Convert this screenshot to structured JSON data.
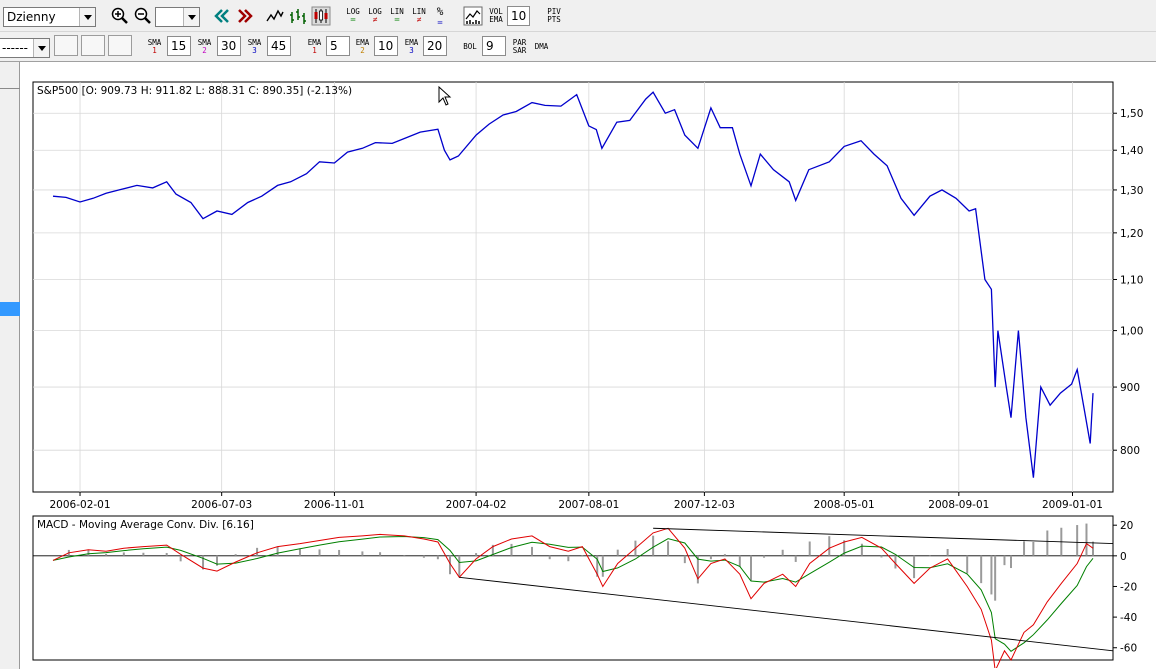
{
  "toolbar1": {
    "interval_value": "Dzienny",
    "zoom_in_icon": "magnifier-plus-icon",
    "zoom_out_icon": "magnifier-minus-icon",
    "zoom_value": "",
    "log_label": "LOG",
    "log2_label": "LOG",
    "lin_label": "LIN",
    "lin2_label": "LIN",
    "percent_label": "%",
    "vol_label": "VOL",
    "ema_label": "EMA",
    "vol_ema_value": "10",
    "piv_label": "PIV",
    "pts_label": "PTS"
  },
  "toolbar2": {
    "line_style_value": "------",
    "sma_label": "SMA",
    "sma1_num": "1",
    "sma1_value": "15",
    "sma2_num": "2",
    "sma2_value": "30",
    "sma3_num": "3",
    "sma3_value": "45",
    "ema_label": "EMA",
    "ema1_num": "1",
    "ema1_value": "5",
    "ema2_num": "2",
    "ema2_value": "10",
    "ema3_num": "3",
    "ema3_value": "20",
    "bol_label": "BOL",
    "bol_value": "9",
    "par_label": "PAR",
    "sar_label": "SAR",
    "dma_label": "DMA"
  },
  "colors": {
    "price": "#0000cc",
    "macd_red": "#e00000",
    "macd_green": "#008000",
    "hist": "#9a9a9a",
    "grid": "#d8d8d8",
    "trend": "#000000",
    "selection": "#3399ff"
  },
  "chart_data": [
    {
      "type": "line",
      "title": "S&P500 [O: 909.73  H: 911.82  L: 888.31  C: 890.35] (-2.13%)",
      "scale": "log",
      "ylim": [
        740,
        1590
      ],
      "y_ticks": [
        800,
        900,
        1000,
        1100,
        1200,
        1300,
        1400,
        1500
      ],
      "y_tick_labels": [
        "800",
        "900",
        "1,00",
        "1,10",
        "1,20",
        "1,30",
        "1,40",
        "1,50"
      ],
      "x_ticks": [
        "2006-02-01",
        "2006-07-03",
        "2006-11-01",
        "2007-04-02",
        "2007-08-01",
        "2007-12-03",
        "2008-05-01",
        "2008-09-01",
        "2009-01-01"
      ],
      "x_range": [
        "2006-01-03",
        "2009-01-23"
      ],
      "grid": true,
      "series": [
        {
          "x": [
            "2006-01-03",
            "2006-01-17",
            "2006-02-01",
            "2006-02-15",
            "2006-03-01",
            "2006-03-15",
            "2006-04-03",
            "2006-04-20",
            "2006-05-05",
            "2006-05-15",
            "2006-05-31",
            "2006-06-13",
            "2006-06-28",
            "2006-07-14",
            "2006-07-31",
            "2006-08-15",
            "2006-09-01",
            "2006-09-15",
            "2006-10-02",
            "2006-10-16",
            "2006-11-01",
            "2006-11-15",
            "2006-12-01",
            "2006-12-15",
            "2007-01-02",
            "2007-01-16",
            "2007-02-01",
            "2007-02-20",
            "2007-02-27",
            "2007-03-05",
            "2007-03-14",
            "2007-04-02",
            "2007-04-16",
            "2007-05-01",
            "2007-05-15",
            "2007-06-01",
            "2007-06-15",
            "2007-07-02",
            "2007-07-19",
            "2007-08-01",
            "2007-08-09",
            "2007-08-15",
            "2007-08-31",
            "2007-09-14",
            "2007-10-01",
            "2007-10-09",
            "2007-10-22",
            "2007-11-01",
            "2007-11-12",
            "2007-11-26",
            "2007-12-10",
            "2007-12-20",
            "2008-01-02",
            "2008-01-10",
            "2008-01-22",
            "2008-02-01",
            "2008-02-15",
            "2008-03-03",
            "2008-03-10",
            "2008-03-24",
            "2008-04-15",
            "2008-05-01",
            "2008-05-19",
            "2008-06-02",
            "2008-06-16",
            "2008-07-01",
            "2008-07-15",
            "2008-08-01",
            "2008-08-14",
            "2008-08-29",
            "2008-09-12",
            "2008-09-19",
            "2008-09-29",
            "2008-10-06",
            "2008-10-10",
            "2008-10-13",
            "2008-10-22",
            "2008-10-27",
            "2008-11-04",
            "2008-11-12",
            "2008-11-20",
            "2008-11-28",
            "2008-12-08",
            "2008-12-19",
            "2008-12-31",
            "2009-01-06",
            "2009-01-14",
            "2009-01-20",
            "2009-01-23"
          ],
          "values": [
            1285,
            1282,
            1271,
            1280,
            1292,
            1300,
            1311,
            1305,
            1320,
            1290,
            1270,
            1232,
            1250,
            1242,
            1270,
            1285,
            1311,
            1320,
            1340,
            1370,
            1367,
            1395,
            1405,
            1420,
            1418,
            1432,
            1448,
            1456,
            1400,
            1375,
            1385,
            1440,
            1470,
            1495,
            1505,
            1530,
            1522,
            1520,
            1553,
            1465,
            1455,
            1405,
            1475,
            1480,
            1540,
            1560,
            1500,
            1510,
            1440,
            1405,
            1515,
            1460,
            1460,
            1390,
            1310,
            1390,
            1350,
            1320,
            1275,
            1350,
            1370,
            1410,
            1425,
            1390,
            1360,
            1280,
            1240,
            1285,
            1300,
            1280,
            1250,
            1255,
            1100,
            1080,
            900,
            1000,
            900,
            850,
            1000,
            850,
            760,
            900,
            870,
            890,
            905,
            930,
            860,
            810,
            890
          ]
        }
      ]
    },
    {
      "type": "line",
      "title": "MACD - Moving Average Conv. Div. [6.16]",
      "ylim": [
        -68,
        26
      ],
      "y_ticks": [
        20,
        0,
        -20,
        -40,
        -60
      ],
      "y_tick_labels": [
        "20",
        "0",
        "-20",
        "-40",
        "-60"
      ],
      "grid": false,
      "series": [
        {
          "x": [
            "2006-01-03",
            "2006-01-20",
            "2006-02-10",
            "2006-03-01",
            "2006-03-20",
            "2006-04-10",
            "2006-05-05",
            "2006-05-20",
            "2006-06-13",
            "2006-06-28",
            "2006-07-18",
            "2006-08-10",
            "2006-09-01",
            "2006-09-25",
            "2006-10-16",
            "2006-11-06",
            "2006-12-01",
            "2006-12-20",
            "2007-01-15",
            "2007-02-05",
            "2007-02-20",
            "2007-03-05",
            "2007-03-15",
            "2007-04-02",
            "2007-04-20",
            "2007-05-10",
            "2007-06-01",
            "2007-06-20",
            "2007-07-10",
            "2007-07-25",
            "2007-08-10",
            "2007-08-16",
            "2007-09-01",
            "2007-09-20",
            "2007-10-09",
            "2007-10-25",
            "2007-11-12",
            "2007-11-26",
            "2007-12-10",
            "2007-12-25",
            "2008-01-10",
            "2008-01-22",
            "2008-02-05",
            "2008-02-25",
            "2008-03-10",
            "2008-03-25",
            "2008-04-15",
            "2008-05-01",
            "2008-05-20",
            "2008-06-10",
            "2008-06-25",
            "2008-07-15",
            "2008-08-01",
            "2008-08-20",
            "2008-09-10",
            "2008-09-25",
            "2008-10-06",
            "2008-10-10",
            "2008-10-20",
            "2008-10-27",
            "2008-11-10",
            "2008-11-20",
            "2008-12-05",
            "2008-12-20",
            "2009-01-06",
            "2009-01-16",
            "2009-01-23"
          ],
          "values": [
            -3,
            2,
            4,
            3,
            5,
            6,
            7,
            1,
            -8,
            -10,
            -4,
            2,
            6,
            8,
            10,
            12,
            13,
            14,
            13,
            11,
            9,
            -5,
            -14,
            -2,
            6,
            11,
            13,
            6,
            3,
            6,
            -12,
            -20,
            -5,
            5,
            15,
            18,
            5,
            -15,
            -5,
            -2,
            -12,
            -28,
            -18,
            -12,
            -20,
            -5,
            5,
            9,
            12,
            5,
            -5,
            -18,
            -8,
            -2,
            -20,
            -35,
            -55,
            -75,
            -62,
            -68,
            -50,
            -45,
            -30,
            -18,
            -5,
            8,
            5
          ]
        }
      ]
    }
  ]
}
